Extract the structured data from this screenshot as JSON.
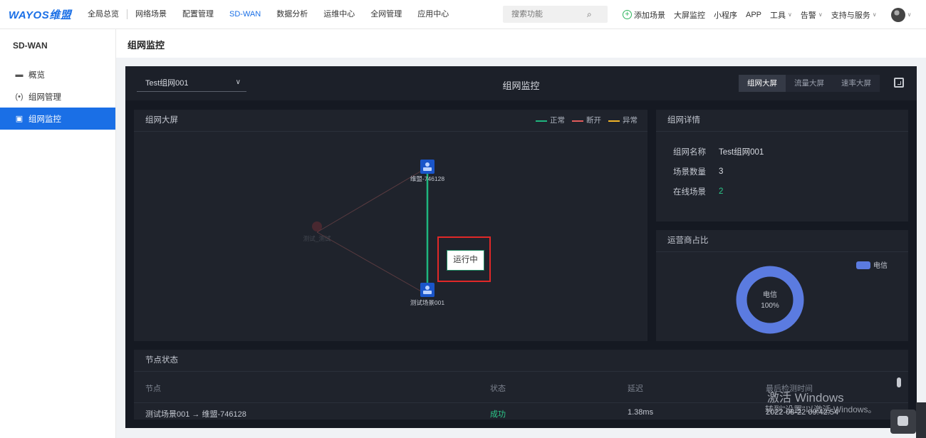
{
  "brand": {
    "logo_text": "WAYOS维盟"
  },
  "topnav": {
    "items": [
      "全局总览",
      "网络场景",
      "配置管理",
      "SD-WAN",
      "数据分析",
      "运维中心",
      "全网管理",
      "应用中心"
    ],
    "active": "SD-WAN",
    "search_placeholder": "搜索功能",
    "right_items": [
      "添加场景",
      "大屏监控",
      "小程序",
      "APP",
      "工具",
      "告警",
      "支持与服务"
    ]
  },
  "sidebar": {
    "title": "SD-WAN",
    "items": [
      {
        "label": "概览",
        "icon": "monitor-icon"
      },
      {
        "label": "组网管理",
        "icon": "broadcast-icon"
      },
      {
        "label": "组网监控",
        "icon": "screen-icon"
      }
    ],
    "active": "组网监控"
  },
  "page": {
    "title": "组网监控"
  },
  "board": {
    "network_select": "Test组网001",
    "title": "组网监控",
    "tabs": [
      "组网大屏",
      "流量大屏",
      "速率大屏"
    ],
    "active_tab": "组网大屏"
  },
  "topology": {
    "title": "组网大屏",
    "legend": [
      {
        "label": "正常",
        "color": "#1fb57f"
      },
      {
        "label": "断开",
        "color": "#e25c5c"
      },
      {
        "label": "异常",
        "color": "#f0b429"
      }
    ],
    "nodes": [
      "维盟-746128",
      "测试场景001",
      "测试_测试"
    ],
    "status_label": "运行中"
  },
  "detail": {
    "title": "组网详情",
    "rows": [
      {
        "key": "组网名称",
        "value": "Test组网001"
      },
      {
        "key": "场景数量",
        "value": "3"
      },
      {
        "key": "在线场景",
        "value": "2"
      }
    ]
  },
  "carrier": {
    "title": "运营商占比",
    "legend_label": "电信",
    "center_label": "电信",
    "center_value": "100%",
    "color": "#5b7be0"
  },
  "nodes_table": {
    "title": "节点状态",
    "headers": [
      "节点",
      "状态",
      "延迟",
      "最后检测时间"
    ],
    "row": {
      "node": "测试场景001 → 维盟-746128",
      "status": "成功",
      "latency": "1.38ms",
      "time": "2022-08-22 09:42:54"
    }
  },
  "watermark": {
    "line1": "激活 Windows",
    "line2": "转到\"设置\"以激活 Windows。"
  }
}
